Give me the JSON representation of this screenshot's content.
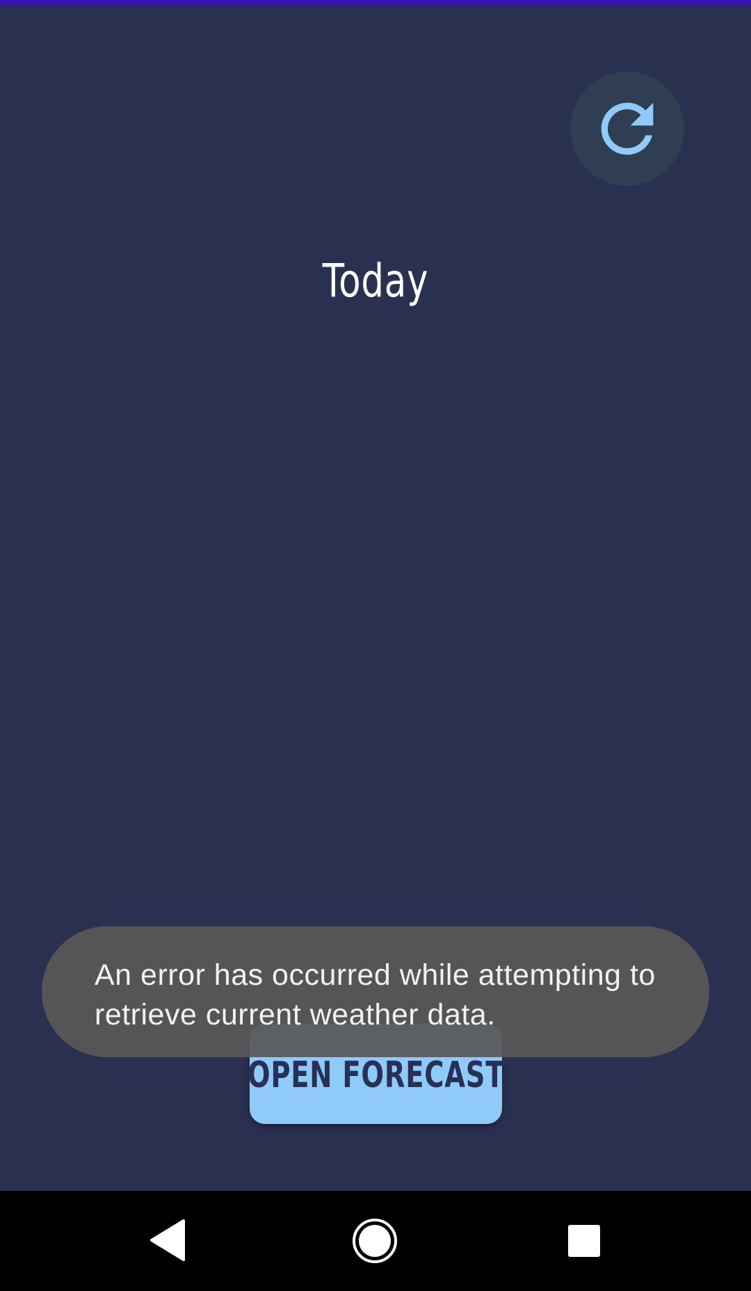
{
  "screen": {
    "title": "Today"
  },
  "actions": {
    "refresh_icon": "refresh-icon",
    "open_forecast_label": "OPEN FORECAST"
  },
  "toast": {
    "message": "An error has occurred while attempting to retrieve current weather data."
  },
  "navigation": {
    "back_icon": "back-triangle-icon",
    "home_icon": "home-circle-icon",
    "recents_icon": "recents-square-icon"
  },
  "colors": {
    "background": "#2a3150",
    "status_strip": "#3a13b8",
    "accent": "#90caf9",
    "refresh_circle": "#2f3e52",
    "toast_background": "#585858",
    "nav_bar": "#000000"
  }
}
